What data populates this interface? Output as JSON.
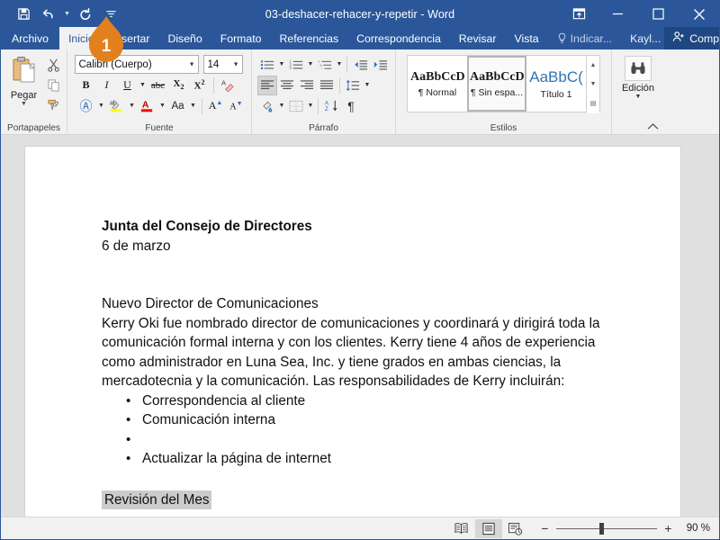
{
  "titlebar": {
    "title": "03-deshacer-rehacer-y-repetir  -  Word",
    "qat": [
      {
        "name": "save-icon",
        "label": "Guardar"
      },
      {
        "name": "undo-icon",
        "label": "Deshacer"
      },
      {
        "name": "redo-icon",
        "label": "Rehacer"
      },
      {
        "name": "customize-qat-icon",
        "label": "Personalizar barra de herramientas de acceso rápido"
      }
    ],
    "window": [
      {
        "name": "ribbon-display-options-icon",
        "label": "Opciones de presentación de la cinta de opciones"
      },
      {
        "name": "minimize-icon",
        "label": "Minimizar"
      },
      {
        "name": "maximize-icon",
        "label": "Maximizar"
      },
      {
        "name": "close-icon",
        "label": "Cerrar"
      }
    ]
  },
  "tabs": [
    {
      "id": "archivo",
      "label": "Archivo"
    },
    {
      "id": "inicio",
      "label": "Inicio"
    },
    {
      "id": "insertar",
      "label": "Insertar"
    },
    {
      "id": "diseno",
      "label": "Diseño"
    },
    {
      "id": "formato",
      "label": "Formato"
    },
    {
      "id": "referencias",
      "label": "Referencias"
    },
    {
      "id": "correspondencia",
      "label": "Correspondencia"
    },
    {
      "id": "revisar",
      "label": "Revisar"
    },
    {
      "id": "vista",
      "label": "Vista"
    }
  ],
  "tellme": {
    "label": "Indicar..."
  },
  "account": {
    "label": "Kayl..."
  },
  "share": {
    "label": "Compartir"
  },
  "ribbon": {
    "clipboard": {
      "group_label": "Portapapeles",
      "paste_label": "Pegar",
      "buttons": [
        {
          "name": "cut-icon",
          "label": "Cortar"
        },
        {
          "name": "copy-icon",
          "label": "Copiar"
        },
        {
          "name": "format-painter-icon",
          "label": "Copiar formato"
        }
      ]
    },
    "font": {
      "group_label": "Fuente",
      "font_name": "Calibri (Cuerpo)",
      "font_size": "14",
      "buttons": [
        {
          "name": "bold-button",
          "label": "B"
        },
        {
          "name": "italic-button",
          "label": "I"
        },
        {
          "name": "underline-button",
          "label": "U"
        },
        {
          "name": "strikethrough-button",
          "label": "abc"
        },
        {
          "name": "subscript-button",
          "label": "X₂"
        },
        {
          "name": "superscript-button",
          "label": "X²"
        },
        {
          "name": "clear-formatting-button",
          "label": "Borrar formato"
        },
        {
          "name": "text-effects-button",
          "label": "A"
        },
        {
          "name": "text-highlight-button",
          "label": "ab"
        },
        {
          "name": "font-color-button",
          "label": "A"
        },
        {
          "name": "change-case-button",
          "label": "Aa"
        },
        {
          "name": "grow-font-button",
          "label": "A"
        },
        {
          "name": "shrink-font-button",
          "label": "A"
        }
      ],
      "highlight_color": "#ffff00",
      "font_color": "#ff0000"
    },
    "paragraph": {
      "group_label": "Párrafo",
      "buttons": [
        {
          "name": "bullets-button",
          "label": "Viñetas"
        },
        {
          "name": "numbering-button",
          "label": "Numeración"
        },
        {
          "name": "multilevel-list-button",
          "label": "Lista multinivel"
        },
        {
          "name": "decrease-indent-button",
          "label": "Disminuir sangría"
        },
        {
          "name": "increase-indent-button",
          "label": "Aumentar sangría"
        },
        {
          "name": "align-left-button",
          "label": "Alinear a la izquierda"
        },
        {
          "name": "align-center-button",
          "label": "Centrar"
        },
        {
          "name": "align-right-button",
          "label": "Alinear a la derecha"
        },
        {
          "name": "justify-button",
          "label": "Justificar"
        },
        {
          "name": "line-spacing-button",
          "label": "Espaciado"
        },
        {
          "name": "shading-button",
          "label": "Sombreado"
        },
        {
          "name": "borders-button",
          "label": "Bordes"
        },
        {
          "name": "sort-button",
          "label": "Ordenar"
        },
        {
          "name": "show-marks-button",
          "label": "Mostrar todo"
        }
      ]
    },
    "styles": {
      "group_label": "Estilos",
      "items": [
        {
          "preview": "AaBbCcDc",
          "name": "¶ Normal",
          "selected": false
        },
        {
          "preview": "AaBbCcDc",
          "name": "¶ Sin espa...",
          "selected": true
        },
        {
          "preview": "AaBbC(",
          "name": "Título 1",
          "selected": false
        }
      ]
    },
    "editing": {
      "group_label": "Edición",
      "label": "Edición",
      "icon": "binoculars-icon"
    },
    "collapse_label": "Contraer la cinta de opciones"
  },
  "document": {
    "heading": "Junta del Consejo de Directores",
    "date": "6 de marzo",
    "section_title": "Nuevo Director de Comunicaciones",
    "paragraph": "Kerry Oki fue nombrado director de comunicaciones y coordinará y dirigirá toda la comunicación formal interna y con los clientes. Kerry tiene 4 años de experiencia como administrador en Luna Sea, Inc. y tiene grados en ambas ciencias, la mercadotecnia y la comunicación. Las responsabilidades de Kerry incluirán:",
    "bullets": [
      "Correspondencia al cliente",
      "Comunicación interna",
      "",
      "Actualizar la página de internet"
    ],
    "selected_text": "Revisión del Mes"
  },
  "statusbar": {
    "views": [
      {
        "name": "read-mode-view-button",
        "label": "Modo de lectura",
        "selected": false
      },
      {
        "name": "print-layout-view-button",
        "label": "Diseño de impresión",
        "selected": true
      },
      {
        "name": "web-layout-view-button",
        "label": "Diseño web",
        "selected": false
      }
    ],
    "zoom_out_label": "−",
    "zoom_in_label": "+",
    "zoom_level": "90 %"
  },
  "callout": {
    "number": "1",
    "color": "#e2801e"
  }
}
